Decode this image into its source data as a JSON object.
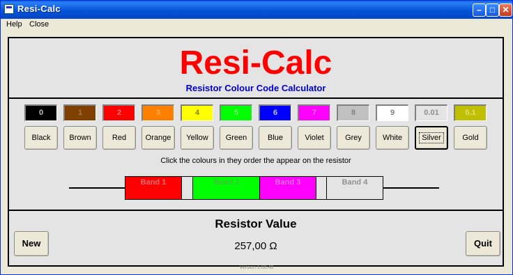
{
  "window": {
    "title": "Resi-Calc",
    "min_glyph": "–",
    "max_glyph": "□",
    "close_glyph": "✕"
  },
  "menu": [
    "Help",
    "Close"
  ],
  "header": {
    "logo": "Resi-Calc",
    "subtitle": "Resistor Colour Code Calculator"
  },
  "colours": [
    {
      "name": "Black",
      "value": "0",
      "bg": "#000000",
      "fg": "#C0C0C0"
    },
    {
      "name": "Brown",
      "value": "1",
      "bg": "#804000",
      "fg": "#A07850"
    },
    {
      "name": "Red",
      "value": "2",
      "bg": "#FF0000",
      "fg": "#FF8080"
    },
    {
      "name": "Orange",
      "value": "3",
      "bg": "#FF8000",
      "fg": "#FFB060"
    },
    {
      "name": "Yellow",
      "value": "4",
      "bg": "#FFFF00",
      "fg": "#808000"
    },
    {
      "name": "Green",
      "value": "5",
      "bg": "#00FF00",
      "fg": "#80FF80"
    },
    {
      "name": "Blue",
      "value": "6",
      "bg": "#0000FF",
      "fg": "#C0C0FF"
    },
    {
      "name": "Violet",
      "value": "7",
      "bg": "#FF00FF",
      "fg": "#FF80FF"
    },
    {
      "name": "Grey",
      "value": "8",
      "bg": "#C0C0C0",
      "fg": "#808080"
    },
    {
      "name": "White",
      "value": "9",
      "bg": "#FFFFFF",
      "fg": "#808080"
    },
    {
      "name": "Silver",
      "value": "0.01",
      "bg": "#E4E4E4",
      "fg": "#909090"
    },
    {
      "name": "Gold",
      "value": "0.1",
      "bg": "#C0C000",
      "fg": "#E0E080"
    }
  ],
  "selected_colour": "Silver",
  "instruction": "Click the colours in they order the appear on the resistor",
  "bands": [
    {
      "label": "Band 1",
      "bg": "#FF0000",
      "fg": "#E07070"
    },
    {
      "label": "Band 2",
      "bg": "#00FF00",
      "fg": "#40C040"
    },
    {
      "label": "Band 3",
      "bg": "#FF00FF",
      "fg": "#E070E0"
    },
    {
      "label": "Band 4",
      "bg": "#E4E4E4",
      "fg": "#909090"
    }
  ],
  "result": {
    "title": "Resistor Value",
    "value": "257,00 Ω"
  },
  "buttons": {
    "new": "New",
    "quit": "Quit"
  },
  "version": "Version 1.00.40"
}
